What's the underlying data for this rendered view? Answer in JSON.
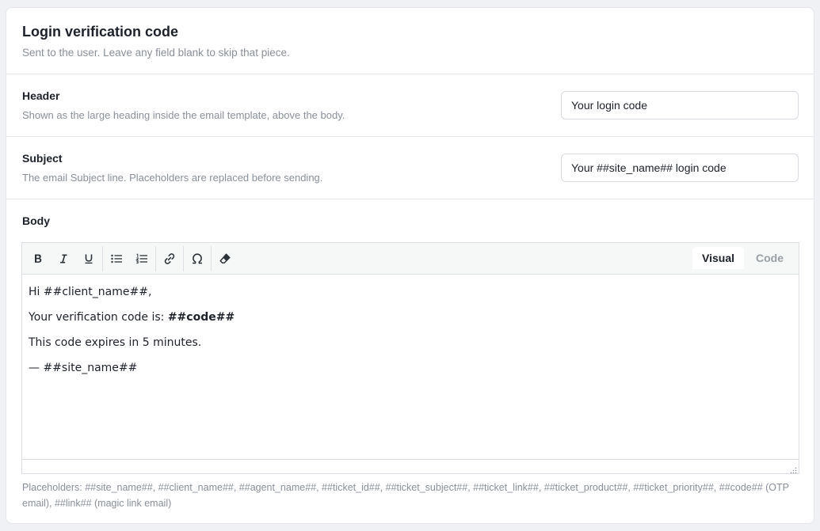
{
  "header": {
    "title": "Login verification code",
    "subtitle": "Sent to the user. Leave any field blank to skip that piece."
  },
  "fields": {
    "header": {
      "label": "Header",
      "description": "Shown as the large heading inside the email template, above the body.",
      "value": "Your login code"
    },
    "subject": {
      "label": "Subject",
      "description": "The email Subject line. Placeholders are replaced before sending.",
      "value": "Your ##site_name## login code"
    }
  },
  "body": {
    "label": "Body",
    "tabs": {
      "visual": "Visual",
      "code": "Code"
    },
    "toolbar_icons": [
      "bold-icon",
      "italic-icon",
      "underline-icon",
      "bullet-list-icon",
      "numbered-list-icon",
      "link-icon",
      "special-character-icon",
      "clear-formatting-icon"
    ],
    "content": {
      "line1": "Hi ##client_name##,",
      "line2_prefix": "Your verification code is: ",
      "line2_code": "##code##",
      "line3": "This code expires in 5 minutes.",
      "line4": "— ##site_name##"
    },
    "placeholders_help": "Placeholders: ##site_name##, ##client_name##, ##agent_name##, ##ticket_id##, ##ticket_subject##, ##ticket_link##, ##ticket_product##, ##ticket_priority##, ##code## (OTP email), ##link## (magic link email)"
  },
  "colors": {
    "card_background": "#ffffff",
    "page_background": "#f0f1f4",
    "muted_text": "#8a9099",
    "toolbar_background": "#f6f7f7"
  }
}
